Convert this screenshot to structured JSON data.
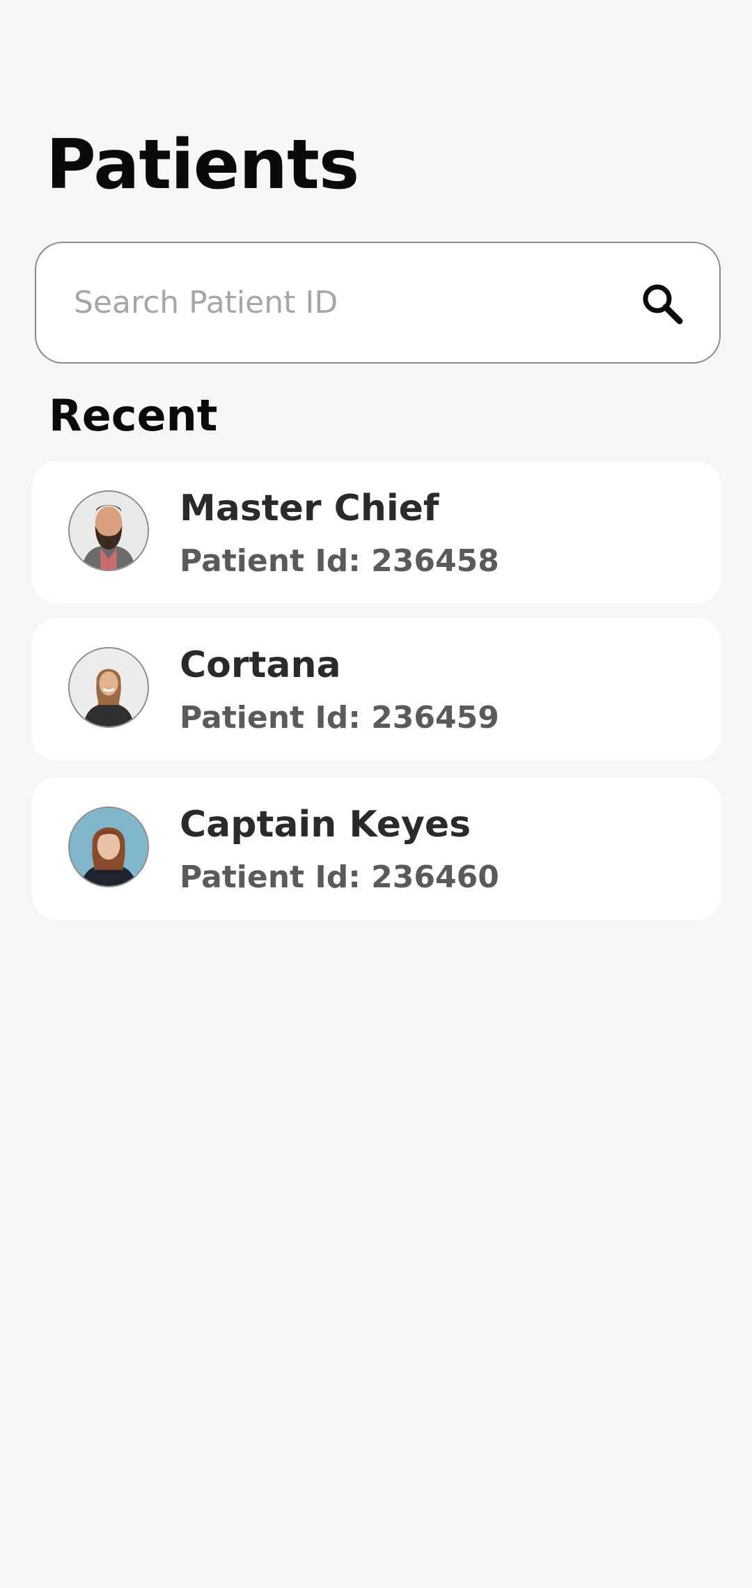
{
  "header": {
    "title": "Patients"
  },
  "search": {
    "placeholder": "Search Patient ID",
    "value": "",
    "icon": "search-icon"
  },
  "recent": {
    "title": "Recent",
    "patients": [
      {
        "name": "Master Chief",
        "id_label": "Patient Id: 236458"
      },
      {
        "name": "Cortana",
        "id_label": "Patient Id: 236459"
      },
      {
        "name": "Captain Keyes",
        "id_label": "Patient Id: 236460"
      }
    ]
  },
  "colors": {
    "background": "#f6f6f6",
    "card": "#ffffff",
    "title": "#0a0a0a",
    "name": "#2a2a2a",
    "id_text": "#5a5a5a",
    "placeholder": "#a6a6a6"
  }
}
